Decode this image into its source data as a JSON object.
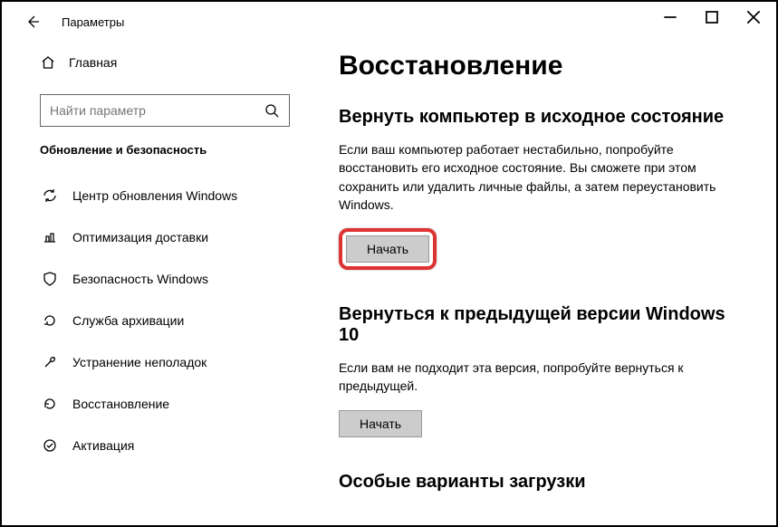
{
  "titlebar": {
    "title": "Параметры"
  },
  "sidebar": {
    "home": "Главная",
    "search_placeholder": "Найти параметр",
    "section": "Обновление и безопасность",
    "items": [
      {
        "label": "Центр обновления Windows"
      },
      {
        "label": "Оптимизация доставки"
      },
      {
        "label": "Безопасность Windows"
      },
      {
        "label": "Служба архивации"
      },
      {
        "label": "Устранение неполадок"
      },
      {
        "label": "Восстановление"
      },
      {
        "label": "Активация"
      }
    ]
  },
  "main": {
    "title": "Восстановление",
    "reset": {
      "heading": "Вернуть компьютер в исходное состояние",
      "text": "Если ваш компьютер работает нестабильно, попробуйте восстановить его исходное состояние. Вы сможете при этом сохранить или удалить личные файлы, а затем переустановить Windows.",
      "button": "Начать"
    },
    "goback": {
      "heading": "Вернуться к предыдущей версии Windows 10",
      "text": "Если вам не подходит эта версия, попробуйте вернуться к предыдущей.",
      "button": "Начать"
    },
    "advanced": {
      "heading": "Особые варианты загрузки"
    }
  }
}
